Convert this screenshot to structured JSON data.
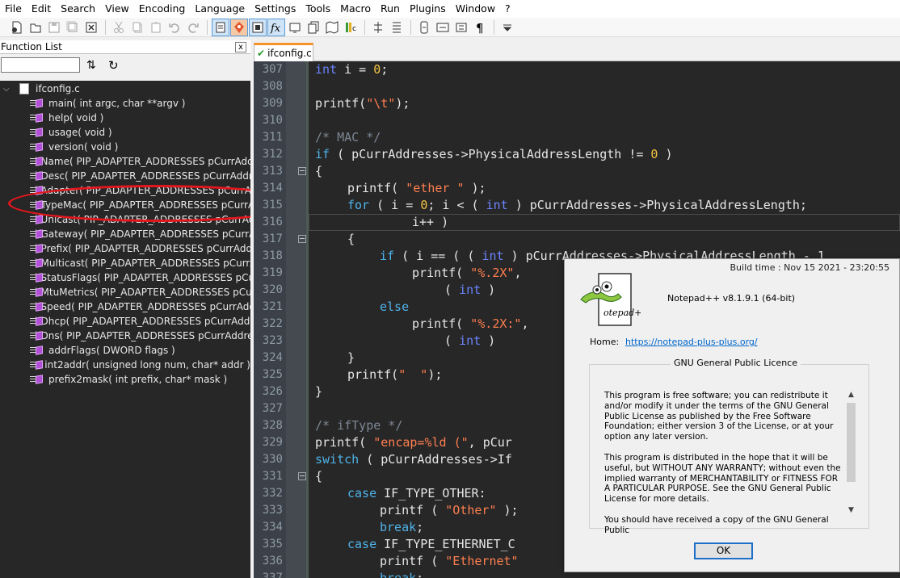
{
  "menu": [
    "File",
    "Edit",
    "Search",
    "View",
    "Encoding",
    "Language",
    "Settings",
    "Tools",
    "Macro",
    "Run",
    "Plugins",
    "Window",
    "?"
  ],
  "function_list": {
    "title": "Function List",
    "close_label": "x",
    "root_file": "ifconfig.c",
    "functions": [
      "main( int argc, char **argv )",
      "help( void )",
      "usage( void )",
      "version( void )",
      "ifName( PIP_ADAPTER_ADDRESSES pCurrAddre",
      "ifDesc( PIP_ADAPTER_ADDRESSES pCurrAddres",
      "ifAdapter( PIP_ADAPTER_ADDRESSES pCurrAdc",
      "ifTypeMac( PIP_ADAPTER_ADDRESSES pCurrAd",
      "ifUnicast( PIP_ADAPTER_ADDRESSES pCurrAdd",
      "ifGateway( PIP_ADAPTER_ADDRESSES pCurrAd",
      "ifPrefix( PIP_ADAPTER_ADDRESSES pCurrAddre",
      "ifMulticast( PIP_ADAPTER_ADDRESSES pCurrAc",
      "ifStatusFlags( PIP_ADAPTER_ADDRESSES pCurr",
      "ifMtuMetrics( PIP_ADAPTER_ADDRESSES pCurr",
      "ifSpeed( PIP_ADAPTER_ADDRESSES pCurrAddre",
      "ifDhcp( PIP_ADAPTER_ADDRESSES pCurrAddres",
      "ifDns( PIP_ADAPTER_ADDRESSES pCurrAddress",
      "addrFlags( DWORD flags )",
      "int2addr( unsigned long num, char* addr )",
      "prefix2mask( int prefix, char* mask )"
    ],
    "highlighted_index": 7
  },
  "tabs": [
    {
      "label": "ifconfig.c",
      "active": true
    }
  ],
  "editor": {
    "current_line_index": 9,
    "lines": [
      {
        "n": "307",
        "fold": false,
        "tokens": [
          [
            "int",
            "ty"
          ],
          [
            " i = ",
            ""
          ],
          [
            "0",
            "num"
          ],
          [
            ";",
            ""
          ]
        ],
        "indent": 1
      },
      {
        "n": "308",
        "fold": false,
        "tokens": [],
        "indent": 0
      },
      {
        "n": "309",
        "fold": false,
        "tokens": [
          [
            "printf(",
            ""
          ],
          [
            "\"\\t\"",
            "st"
          ],
          [
            ");",
            ""
          ]
        ],
        "indent": 1
      },
      {
        "n": "310",
        "fold": false,
        "tokens": [],
        "indent": 0
      },
      {
        "n": "311",
        "fold": false,
        "tokens": [
          [
            "/* MAC */",
            "cm"
          ]
        ],
        "indent": 1
      },
      {
        "n": "312",
        "fold": false,
        "tokens": [
          [
            "if",
            "kw"
          ],
          [
            " ( pCurrAddresses->PhysicalAddressLength != ",
            ""
          ],
          [
            "0",
            "num"
          ],
          [
            " )",
            ""
          ]
        ],
        "indent": 1
      },
      {
        "n": "313",
        "fold": true,
        "tokens": [
          [
            "{",
            ""
          ]
        ],
        "indent": 1
      },
      {
        "n": "314",
        "fold": false,
        "tokens": [
          [
            "printf( ",
            ""
          ],
          [
            "\"ether \"",
            "st"
          ],
          [
            " );",
            ""
          ]
        ],
        "indent": 2
      },
      {
        "n": "315",
        "fold": false,
        "tokens": [
          [
            "for",
            "kw"
          ],
          [
            " ( i = ",
            ""
          ],
          [
            "0",
            "num"
          ],
          [
            "; i < ( ",
            ""
          ],
          [
            "int",
            "ty"
          ],
          [
            " ) pCurrAddresses->PhysicalAddressLength;",
            ""
          ]
        ],
        "indent": 2
      },
      {
        "n": "316",
        "fold": false,
        "tokens": [
          [
            "i++ )",
            ""
          ]
        ],
        "indent": 4
      },
      {
        "n": "317",
        "fold": true,
        "tokens": [
          [
            "{",
            ""
          ]
        ],
        "indent": 2
      },
      {
        "n": "318",
        "fold": false,
        "tokens": [
          [
            "if",
            "kw"
          ],
          [
            " ( i == ( ( ",
            ""
          ],
          [
            "int",
            "ty"
          ],
          [
            " ) pCurrAddresses->PhysicalAddressLength - 1",
            ""
          ]
        ],
        "indent": 3
      },
      {
        "n": "319",
        "fold": false,
        "tokens": [
          [
            "printf( ",
            ""
          ],
          [
            "\"%.2X\"",
            "st"
          ],
          [
            ", ",
            ""
          ]
        ],
        "indent": 4
      },
      {
        "n": "320",
        "fold": false,
        "tokens": [
          [
            "( ",
            ""
          ],
          [
            "int",
            "ty"
          ],
          [
            " )",
            ""
          ]
        ],
        "indent": 5
      },
      {
        "n": "321",
        "fold": false,
        "tokens": [
          [
            "else",
            "kw"
          ]
        ],
        "indent": 3
      },
      {
        "n": "322",
        "fold": false,
        "tokens": [
          [
            "printf( ",
            ""
          ],
          [
            "\"%.2X:\"",
            "st"
          ],
          [
            ", ",
            ""
          ]
        ],
        "indent": 4
      },
      {
        "n": "323",
        "fold": false,
        "tokens": [
          [
            "( ",
            ""
          ],
          [
            "int",
            "ty"
          ],
          [
            " )",
            ""
          ]
        ],
        "indent": 5
      },
      {
        "n": "324",
        "fold": false,
        "tokens": [
          [
            "}",
            ""
          ]
        ],
        "indent": 2
      },
      {
        "n": "325",
        "fold": false,
        "tokens": [
          [
            "printf(",
            ""
          ],
          [
            "\"  \"",
            "st"
          ],
          [
            ");",
            ""
          ]
        ],
        "indent": 2
      },
      {
        "n": "326",
        "fold": false,
        "tokens": [
          [
            "}",
            ""
          ]
        ],
        "indent": 1
      },
      {
        "n": "327",
        "fold": false,
        "tokens": [],
        "indent": 0
      },
      {
        "n": "328",
        "fold": false,
        "tokens": [
          [
            "/* ifType */",
            "cm"
          ]
        ],
        "indent": 1
      },
      {
        "n": "329",
        "fold": false,
        "tokens": [
          [
            "printf( ",
            ""
          ],
          [
            "\"encap=%ld (\"",
            "st"
          ],
          [
            ", pCur",
            ""
          ]
        ],
        "indent": 1
      },
      {
        "n": "330",
        "fold": false,
        "tokens": [
          [
            "switch",
            "kw"
          ],
          [
            " ( pCurrAddresses->If",
            ""
          ]
        ],
        "indent": 1
      },
      {
        "n": "331",
        "fold": true,
        "tokens": [
          [
            "{",
            ""
          ]
        ],
        "indent": 1
      },
      {
        "n": "332",
        "fold": false,
        "tokens": [
          [
            "case",
            "kw"
          ],
          [
            " IF_TYPE_OTHER:",
            ""
          ]
        ],
        "indent": 2
      },
      {
        "n": "333",
        "fold": false,
        "tokens": [
          [
            "printf ( ",
            ""
          ],
          [
            "\"Other\"",
            "st"
          ],
          [
            " );",
            ""
          ]
        ],
        "indent": 3
      },
      {
        "n": "334",
        "fold": false,
        "tokens": [
          [
            "break",
            "kw"
          ],
          [
            ";",
            ""
          ]
        ],
        "indent": 3
      },
      {
        "n": "335",
        "fold": false,
        "tokens": [
          [
            "case",
            "kw"
          ],
          [
            " IF_TYPE_ETHERNET_C",
            ""
          ]
        ],
        "indent": 2
      },
      {
        "n": "336",
        "fold": false,
        "tokens": [
          [
            "printf ( ",
            ""
          ],
          [
            "\"Ethernet\"",
            "st"
          ]
        ],
        "indent": 3
      },
      {
        "n": "337",
        "fold": false,
        "tokens": [
          [
            "break",
            "kw"
          ],
          [
            ";",
            ""
          ]
        ],
        "indent": 3
      }
    ]
  },
  "about": {
    "build_time": "Build time : Nov 15 2021 - 23:20:55",
    "version": "Notepad++ v8.1.9.1   (64-bit)",
    "home_label": "Home:",
    "home_url": "https://notepad-plus-plus.org/",
    "licence_title": "GNU General Public Licence",
    "licence_paragraphs": [
      "This program is free software; you can redistribute it and/or modify it under the terms of the GNU General Public License as published by the Free Software Foundation; either version 3 of the License, or at your option any later version.",
      "This program is distributed in the hope that it will be useful, but WITHOUT ANY WARRANTY; without even the implied warranty of MERCHANTABILITY or FITNESS FOR A PARTICULAR PURPOSE. See the GNU General Public License for more details.",
      "You should have received a copy of the GNU General Public"
    ],
    "ok_label": "OK",
    "logo_text": "otepad++"
  },
  "colors": {
    "editor_bg": "#272727",
    "keyword": "#4fb3ea",
    "type": "#6c84ff",
    "string": "#ff7f50",
    "number": "#f5c443",
    "comment": "#7d8794",
    "highlight_circle": "#e3161d",
    "tab_accent": "#f79228"
  }
}
